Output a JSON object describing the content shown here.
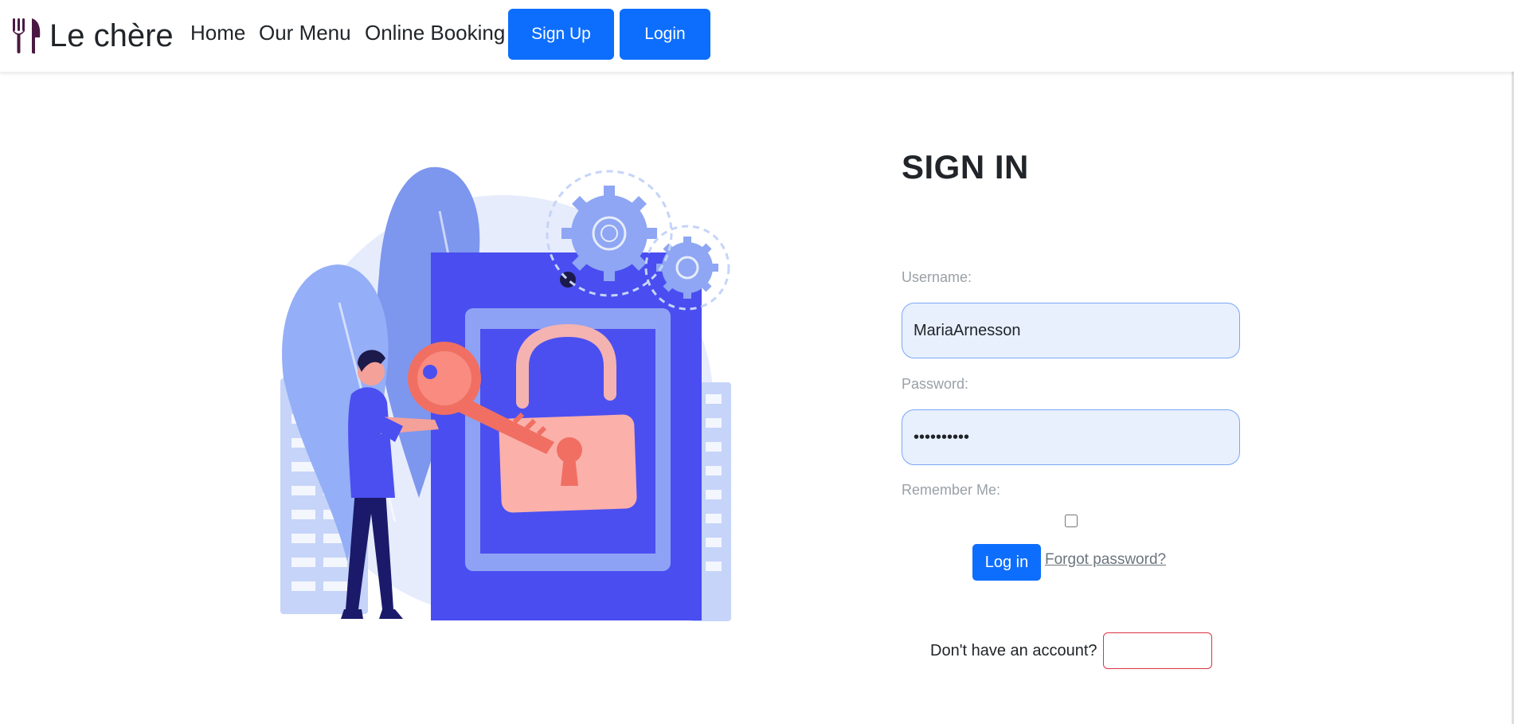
{
  "brand": {
    "name": "Le chère",
    "icon": "cutlery-icon",
    "icon_color": "#4a1942"
  },
  "nav": {
    "links": [
      "Home",
      "Our Menu",
      "Online Booking"
    ],
    "signup_label": "Sign Up",
    "login_label": "Login"
  },
  "colors": {
    "primary": "#0d6efd",
    "danger": "#dc3545",
    "field_bg": "#e8f0fe"
  },
  "form": {
    "title": "SIGN IN",
    "username_label": "Username:",
    "username_value": "MariaArnesson",
    "password_label": "Password:",
    "password_value": "••••••••••",
    "remember_label": "Remember Me:",
    "remember_checked": false,
    "login_label": "Log in",
    "forgot_label": "Forgot password?",
    "no_account_text": "Don't have an account?"
  },
  "illustration": {
    "icon": "unlock-illustration"
  }
}
